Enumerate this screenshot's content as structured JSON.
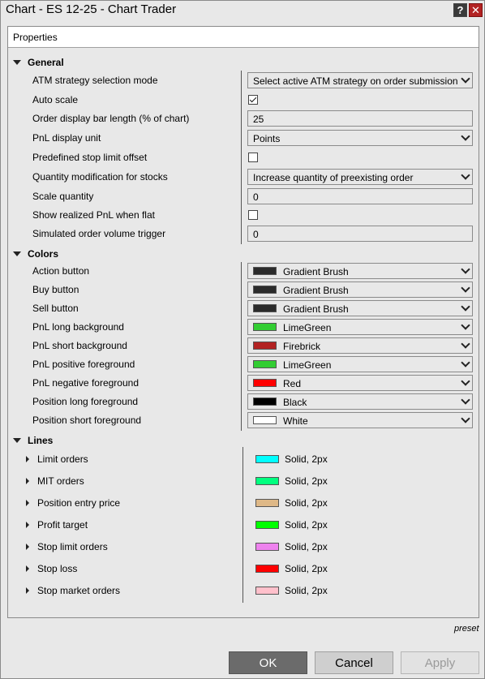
{
  "window": {
    "title": "Chart - ES 12-25 - Chart Trader",
    "help_label": "?",
    "close_label": "✕"
  },
  "panel": {
    "title": "Properties"
  },
  "general": {
    "title": "General",
    "rows": [
      {
        "label": "ATM strategy selection mode",
        "type": "dropdown",
        "value": "Select active ATM strategy on order submission"
      },
      {
        "label": "Auto scale",
        "type": "checkbox",
        "checked": true
      },
      {
        "label": "Order display bar length (% of chart)",
        "type": "text",
        "value": "25"
      },
      {
        "label": "PnL display unit",
        "type": "dropdown",
        "value": "Points"
      },
      {
        "label": "Predefined stop limit offset",
        "type": "checkbox",
        "checked": false
      },
      {
        "label": "Quantity modification for stocks",
        "type": "dropdown",
        "value": "Increase quantity of preexisting order"
      },
      {
        "label": "Scale quantity",
        "type": "text",
        "value": "0"
      },
      {
        "label": "Show realized PnL when flat",
        "type": "checkbox",
        "checked": false
      },
      {
        "label": "Simulated order volume trigger",
        "type": "text",
        "value": "0"
      }
    ]
  },
  "colors": {
    "title": "Colors",
    "rows": [
      {
        "label": "Action button",
        "value": "Gradient Brush",
        "color": "#2b2b2b"
      },
      {
        "label": "Buy button",
        "value": "Gradient Brush",
        "color": "#2b2b2b"
      },
      {
        "label": "Sell button",
        "value": "Gradient Brush",
        "color": "#2b2b2b"
      },
      {
        "label": "PnL long background",
        "value": "LimeGreen",
        "color": "#32cd32"
      },
      {
        "label": "PnL short background",
        "value": "Firebrick",
        "color": "#b22222"
      },
      {
        "label": "PnL positive foreground",
        "value": "LimeGreen",
        "color": "#32cd32"
      },
      {
        "label": "PnL negative foreground",
        "value": "Red",
        "color": "#ff0000"
      },
      {
        "label": "Position long foreground",
        "value": "Black",
        "color": "#000000"
      },
      {
        "label": "Position short foreground",
        "value": "White",
        "color": "#ffffff"
      }
    ]
  },
  "lines": {
    "title": "Lines",
    "rows": [
      {
        "label": "Limit orders",
        "value": "Solid, 2px",
        "color": "#00ffff"
      },
      {
        "label": "MIT orders",
        "value": "Solid, 2px",
        "color": "#00ff7f"
      },
      {
        "label": "Position entry price",
        "value": "Solid, 2px",
        "color": "#deb887"
      },
      {
        "label": "Profit target",
        "value": "Solid, 2px",
        "color": "#00ff00"
      },
      {
        "label": "Stop limit orders",
        "value": "Solid, 2px",
        "color": "#ee82ee"
      },
      {
        "label": "Stop loss",
        "value": "Solid, 2px",
        "color": "#ff0000"
      },
      {
        "label": "Stop market orders",
        "value": "Solid, 2px",
        "color": "#ffc0cb"
      }
    ]
  },
  "footer": {
    "preset_label": "preset",
    "ok_label": "OK",
    "cancel_label": "Cancel",
    "apply_label": "Apply"
  }
}
